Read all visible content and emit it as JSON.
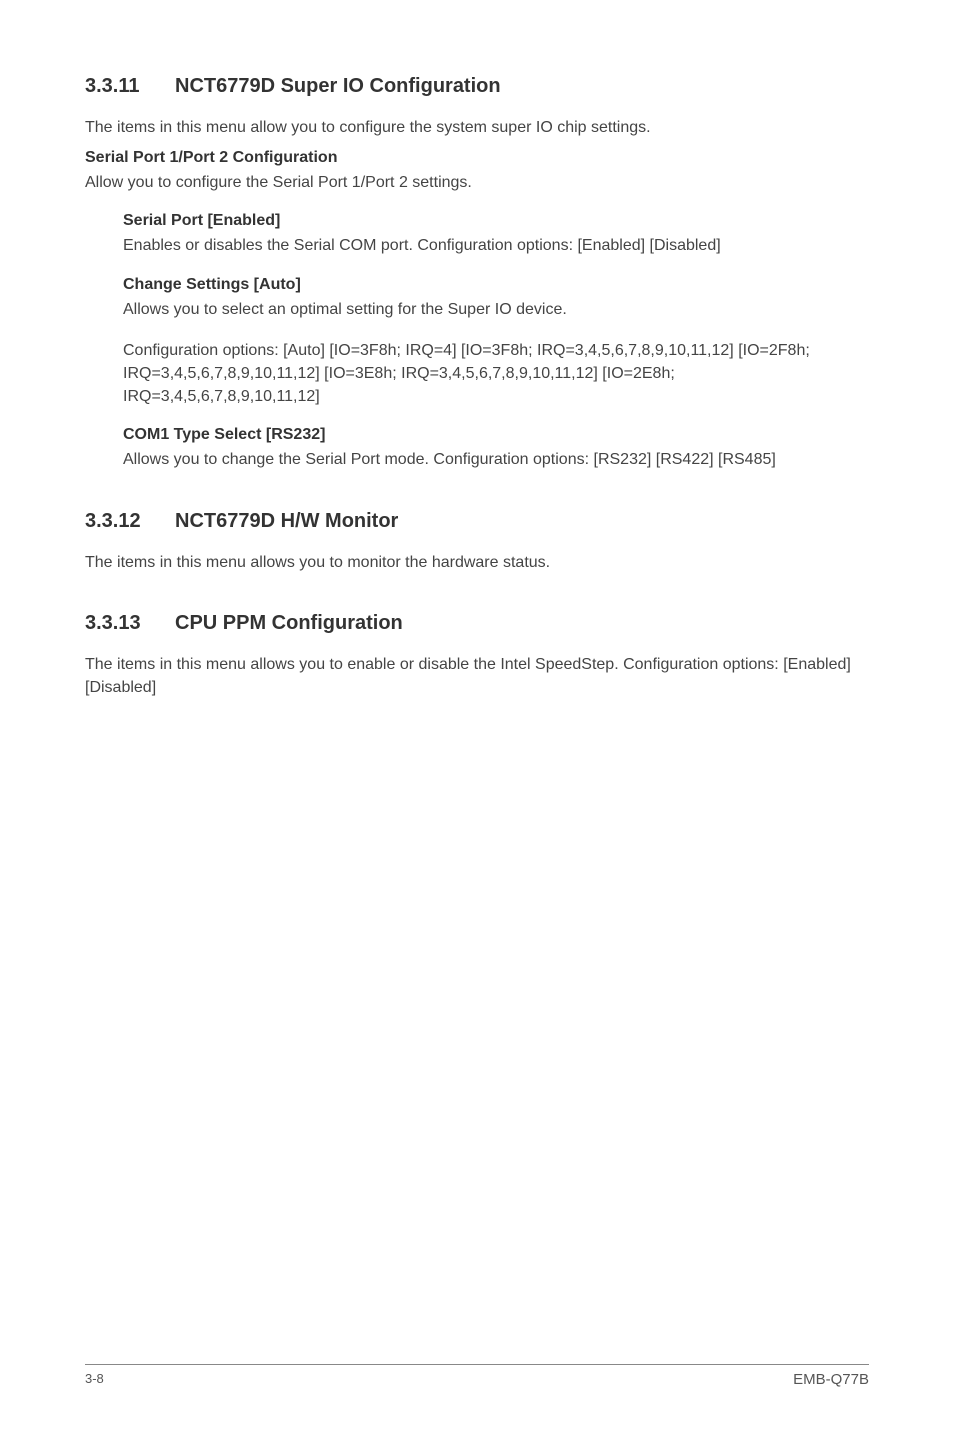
{
  "sections": [
    {
      "number": "3.3.11",
      "title": "NCT6779D Super IO Configuration",
      "intro": "The items in this menu allow you to configure the system super IO chip settings.",
      "subsections": [
        {
          "heading": "Serial Port 1/Port 2 Configuration",
          "text": "Allow you to configure the Serial Port 1/Port 2 settings.",
          "items": [
            {
              "heading": "Serial Port [Enabled]",
              "paragraphs": [
                "Enables or disables the Serial COM port. Configuration options: [Enabled] [Disabled]"
              ]
            },
            {
              "heading": "Change Settings [Auto]",
              "paragraphs": [
                "Allows you to select an optimal setting for the Super IO device.",
                "Configuration options: [Auto] [IO=3F8h; IRQ=4] [IO=3F8h; IRQ=3,4,5,6,7,8,9,10,11,12] [IO=2F8h; IRQ=3,4,5,6,7,8,9,10,11,12] [IO=3E8h; IRQ=3,4,5,6,7,8,9,10,11,12] [IO=2E8h; IRQ=3,4,5,6,7,8,9,10,11,12]"
              ]
            },
            {
              "heading": "COM1 Type Select [RS232]",
              "paragraphs": [
                "Allows you to change the Serial Port mode. Configuration options: [RS232] [RS422] [RS485]"
              ]
            }
          ]
        }
      ]
    },
    {
      "number": "3.3.12",
      "title": "NCT6779D H/W Monitor",
      "intro": "The items in this menu allows you to monitor the hardware status."
    },
    {
      "number": "3.3.13",
      "title": "CPU PPM Configuration",
      "intro": "The items in this menu allows you to enable or disable the Intel SpeedStep. Configuration options: [Enabled] [Disabled]"
    }
  ],
  "footer": {
    "page": "3-8",
    "product": "EMB-Q77B"
  }
}
